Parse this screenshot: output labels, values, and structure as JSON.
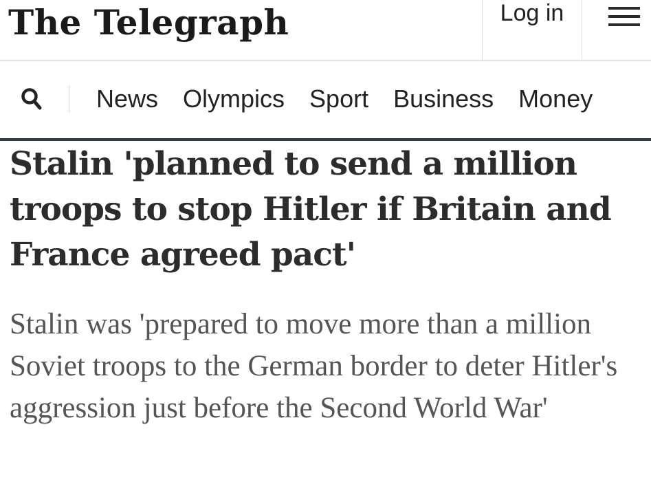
{
  "header": {
    "masthead": "The Telegraph",
    "login_label": "Log in",
    "menu_icon": "hamburger-menu-icon"
  },
  "nav": {
    "search_icon": "search-icon",
    "items": [
      {
        "label": "News"
      },
      {
        "label": "Olympics"
      },
      {
        "label": "Sport"
      },
      {
        "label": "Business"
      },
      {
        "label": "Money"
      }
    ]
  },
  "article": {
    "headline": "Stalin 'planned to send a million troops to stop Hitler if Britain and France agreed pact'",
    "standfirst": "Stalin was 'prepared to move more than a million Soviet troops to the German border to deter Hitler's aggression just before the Second World War'"
  },
  "colors": {
    "nav_underline": "#2b3a44",
    "headline_text": "#2c2c2c",
    "standfirst_text": "#555555"
  }
}
